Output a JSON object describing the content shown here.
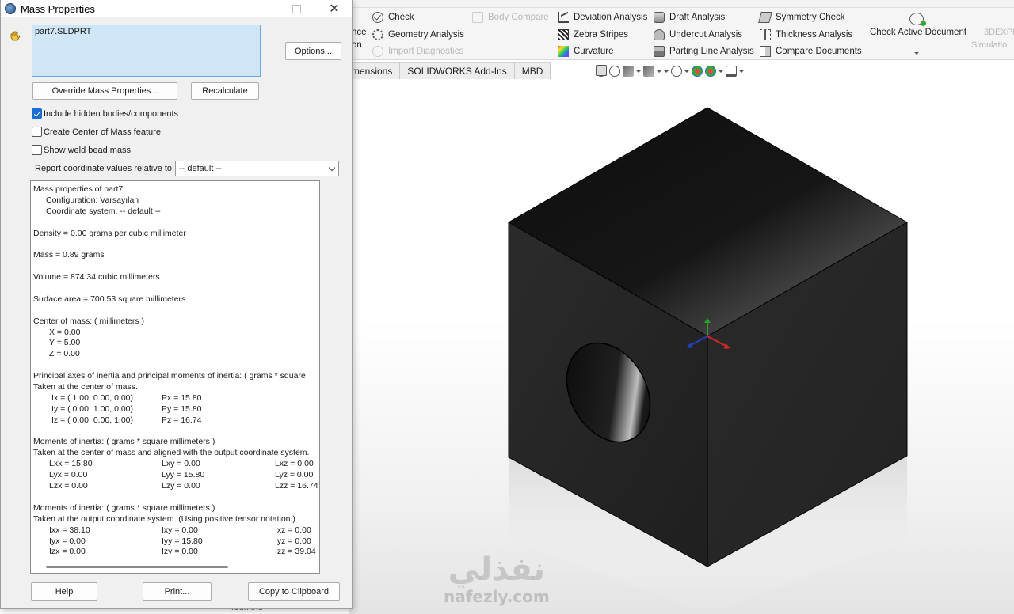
{
  "dialog": {
    "title": "Mass Properties",
    "selected_item": "part7.SLDPRT",
    "buttons": {
      "options": "Options...",
      "override": "Override Mass Properties...",
      "recalculate": "Recalculate",
      "help": "Help",
      "print": "Print...",
      "copy": "Copy to Clipboard"
    },
    "checkboxes": [
      {
        "label": "Include hidden bodies/components",
        "checked": true
      },
      {
        "label": "Create Center of Mass feature",
        "checked": false
      },
      {
        "label": "Show weld bead mass",
        "checked": false
      }
    ],
    "coordinate": {
      "label": "Report coordinate values relative to:",
      "value": "-- default --"
    },
    "results": {
      "title": "Mass properties of part7",
      "configuration": "Configuration: Varsayılan",
      "coordinate_system": "Coordinate system: -- default --",
      "density": "Density = 0.00 grams per cubic millimeter",
      "mass": "Mass = 0.89 grams",
      "volume": "Volume = 874.34 cubic millimeters",
      "surface_area": "Surface area = 700.53  square millimeters",
      "com_header": "Center of mass: ( millimeters )",
      "com_x": "X = 0.00",
      "com_y": "Y = 5.00",
      "com_z": "Z = 0.00",
      "principal_header": "Principal axes of inertia and principal moments of inertia: ( grams *  square",
      "principal_taken": "Taken at the center of mass.",
      "ix": "Ix = ( 1.00,  0.00,  0.00)",
      "iy": "Iy = ( 0.00,  1.00,  0.00)",
      "iz": "Iz = ( 0.00,  0.00,  1.00)",
      "px": "Px = 15.80",
      "py": "Py = 15.80",
      "pz": "Pz = 16.74",
      "moments_header": "Moments of inertia: ( grams *  square millimeters )",
      "moments_taken": "Taken at the center of mass and aligned with the output coordinate system.",
      "lxx": "Lxx = 15.80",
      "lxy": "Lxy = 0.00",
      "lxz": "Lxz = 0.00",
      "lyx": "Lyx = 0.00",
      "lyy": "Lyy = 15.80",
      "lyz": "Lyz = 0.00",
      "lzx": "Lzx = 0.00",
      "lzy": "Lzy = 0.00",
      "lzz": "Lzz = 16.74",
      "moments2_header": "Moments of inertia: ( grams *  square millimeters )",
      "moments2_taken": "Taken at the output coordinate system. (Using positive tensor notation.)",
      "ixx": "Ixx = 38.10",
      "ixy": "Ixy = 0.00",
      "ixz": "Ixz = 0.00",
      "iyx": "Iyx = 0.00",
      "iyy": "Iyy = 15.80",
      "iyz": "Iyz = 0.00",
      "izx": "Izx = 0.00",
      "izy": "Izy = 0.00",
      "izz": "Izz = 39.04"
    }
  },
  "ribbon": {
    "left_fragment_1": "nce",
    "left_fragment_2": "on",
    "col1": [
      "Check",
      "Geometry Analysis",
      "Import Diagnostics"
    ],
    "body_compare": "Body Compare",
    "col2": [
      "Deviation Analysis",
      "Zebra Stripes",
      "Curvature"
    ],
    "col3": [
      "Draft Analysis",
      "Undercut Analysis",
      "Parting Line Analysis"
    ],
    "col4": [
      "Symmetry Check",
      "Thickness Analysis",
      "Compare Documents"
    ],
    "check_active": "Check Active Document",
    "right_fragment_1": "3DEXPE",
    "right_fragment_2": "Simulatio"
  },
  "tabs": [
    "mensions",
    "SOLIDWORKS Add-Ins",
    "MBD"
  ],
  "watermark": {
    "arabic": "نفذلي",
    "latin": "nafezly.com"
  },
  "status_fragment": "Touminu"
}
